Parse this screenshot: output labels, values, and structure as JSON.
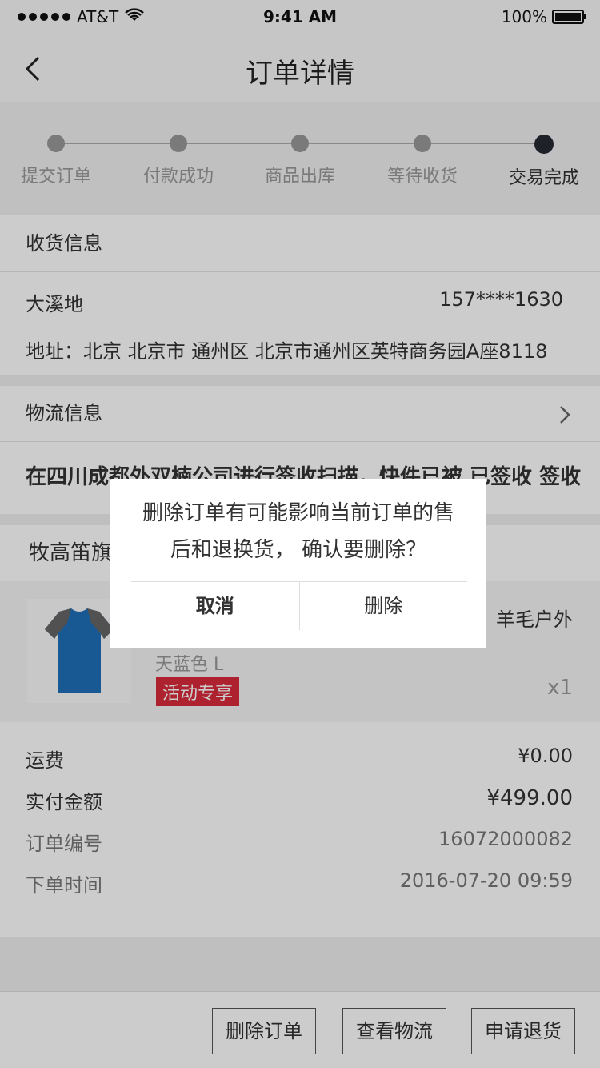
{
  "status_bar": {
    "carrier": "AT&T",
    "time": "9:41 AM",
    "battery": "100%"
  },
  "header": {
    "title": "订单详情"
  },
  "progress": {
    "steps": [
      {
        "label": "提交订单"
      },
      {
        "label": "付款成功"
      },
      {
        "label": "商品出库"
      },
      {
        "label": "等待收货"
      },
      {
        "label": "交易完成"
      }
    ]
  },
  "shipping": {
    "title": "收货信息",
    "name": "大溪地",
    "phone": "157****1630",
    "address": "地址：北京 北京市 通州区 北京市通州区英特商务园A座8118"
  },
  "logistics": {
    "title": "物流信息",
    "latest": "在四川成都外双楠公司进行签收扫描，快件已被 已签收 签收"
  },
  "shop": {
    "name": "牧高笛旗"
  },
  "product": {
    "name_visible": "羊毛户外",
    "variant": "天蓝色   L",
    "tag": "活动专享",
    "qty": "x1"
  },
  "summary": {
    "shipping_label": "运费",
    "shipping_value": "¥0.00",
    "paid_label": "实付金额",
    "paid_value": "¥499.00",
    "order_no_label": "订单编号",
    "order_no_value": "16072000082",
    "order_time_label": "下单时间",
    "order_time_value": "2016-07-20 09:59"
  },
  "actions": {
    "delete": "删除订单",
    "logistics": "查看物流",
    "refund": "申请退货"
  },
  "dialog": {
    "message": "删除订单有可能影响当前订单的售后和退换货， 确认要删除？",
    "cancel": "取消",
    "confirm": "删除"
  }
}
